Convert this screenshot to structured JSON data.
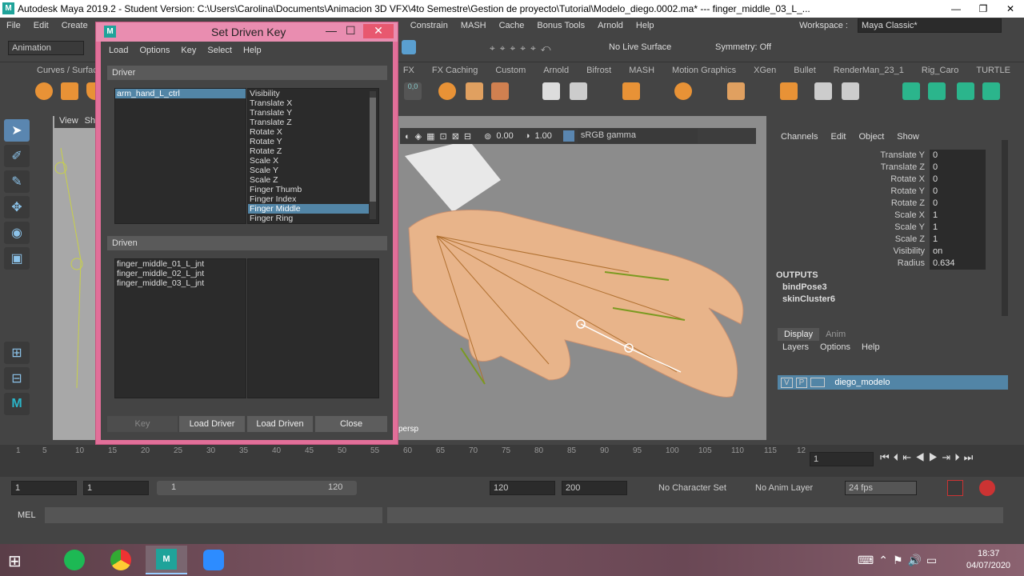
{
  "window": {
    "title": "Autodesk Maya 2019.2 - Student Version: C:\\Users\\Carolina\\Documents\\Animacion 3D VFX\\4to Semestre\\Gestion de proyecto\\Tutorial\\Modelo_diego.0002.ma*   ---   finger_middle_03_L_...",
    "logo": "M",
    "min": "—",
    "max": "❐",
    "close": "✕"
  },
  "menubar": [
    "File",
    "Edit",
    "Create",
    "Constrain",
    "MASH",
    "Cache",
    "Bonus Tools",
    "Arnold",
    "Help"
  ],
  "workspace": {
    "label": "Workspace :",
    "value": "Maya Classic*"
  },
  "menuset": "Animation",
  "live_surface": "No Live Surface",
  "symmetry": "Symmetry: Off",
  "shelf_tabs_left": [
    "Curves / Surfac"
  ],
  "shelf_tabs": [
    "FX",
    "FX Caching",
    "Custom",
    "Arnold",
    "Bifrost",
    "MASH",
    "Motion Graphics",
    "XGen",
    "Bullet",
    "RenderMan_23_1",
    "Rig_Caro",
    "TURTLE"
  ],
  "panel_menu": {
    "view": "View",
    "sh": "Sh"
  },
  "viewport": {
    "value1": "0.00",
    "value2": "1.00",
    "colorspace": "sRGB gamma",
    "camera": "persp"
  },
  "channel_box": {
    "menu": [
      "Channels",
      "Edit",
      "Object",
      "Show"
    ],
    "attrs": [
      {
        "name": "Translate Y",
        "value": "0"
      },
      {
        "name": "Translate Z",
        "value": "0"
      },
      {
        "name": "Rotate X",
        "value": "0"
      },
      {
        "name": "Rotate Y",
        "value": "0"
      },
      {
        "name": "Rotate Z",
        "value": "0"
      },
      {
        "name": "Scale X",
        "value": "1"
      },
      {
        "name": "Scale Y",
        "value": "1"
      },
      {
        "name": "Scale Z",
        "value": "1"
      },
      {
        "name": "Visibility",
        "value": "on"
      },
      {
        "name": "Radius",
        "value": "0.634"
      }
    ],
    "outputs_label": "OUTPUTS",
    "outputs": [
      "bindPose3",
      "skinCluster6"
    ]
  },
  "layer_editor": {
    "tabs": [
      "Display",
      "Anim"
    ],
    "menu": [
      "Layers",
      "Options",
      "Help"
    ],
    "layer": {
      "v": "V",
      "p": "P",
      "name": "diego_modelo"
    }
  },
  "dialog": {
    "title": "Set Driven Key",
    "menu": [
      "Load",
      "Options",
      "Key",
      "Select",
      "Help"
    ],
    "driver_label": "Driver",
    "driver_object": "arm_hand_L_ctrl",
    "driver_attrs": [
      "Visibility",
      "Translate X",
      "Translate Y",
      "Translate Z",
      "Rotate X",
      "Rotate Y",
      "Rotate Z",
      "Scale X",
      "Scale Y",
      "Scale Z",
      "Finger Thumb",
      "Finger Index",
      "Finger Middle",
      "Finger Ring"
    ],
    "driver_selected": "Finger Middle",
    "driven_label": "Driven",
    "driven_objects": [
      "finger_middle_01_L_jnt",
      "finger_middle_02_L_jnt",
      "finger_middle_03_L_jnt"
    ],
    "buttons": {
      "key": "Key",
      "load_driver": "Load Driver",
      "load_driven": "Load Driven",
      "close": "Close"
    },
    "min": "—",
    "max": "☐",
    "close": "✕"
  },
  "timeline": {
    "ticks": [
      "1",
      "5",
      "10",
      "15",
      "20",
      "25",
      "30",
      "35",
      "40",
      "45",
      "50",
      "55",
      "60",
      "65",
      "70",
      "75",
      "80",
      "85",
      "90",
      "95",
      "100",
      "105",
      "110",
      "115",
      "12"
    ],
    "current": "1"
  },
  "range": {
    "start": "1",
    "anim_start": "1",
    "slider_start": "1",
    "slider_end": "120",
    "end": "120",
    "anim_end": "200",
    "character_set": "No Character Set",
    "anim_layer": "No Anim Layer",
    "fps": "24 fps"
  },
  "cmdline": {
    "label": "MEL"
  },
  "taskbar": {
    "time": "18:37",
    "date": "04/07/2020"
  },
  "colors": {
    "accent": "#5285a6",
    "dialog_frame": "#e26f99",
    "skin": "#e8b48a"
  }
}
